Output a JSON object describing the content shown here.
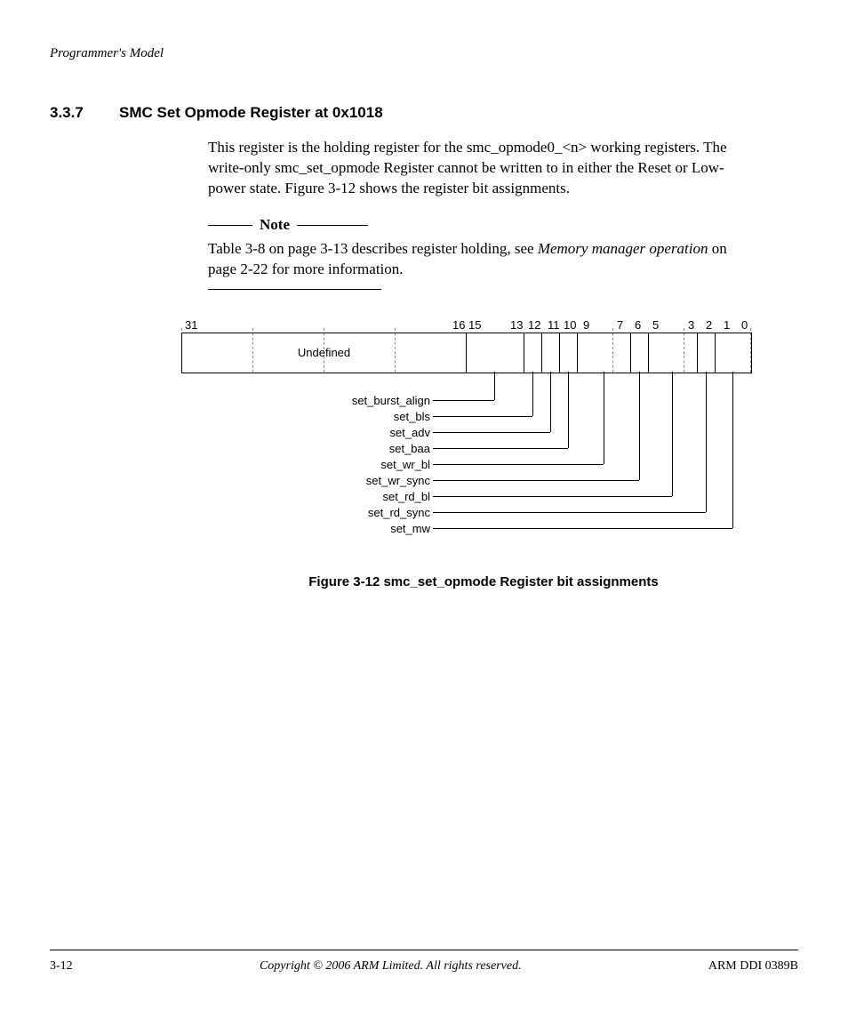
{
  "header": {
    "running": "Programmer's Model"
  },
  "section": {
    "number": "3.3.7",
    "title": "SMC Set Opmode Register at 0x1018"
  },
  "paragraph1": "This register is the holding register for the smc_opmode0_<n> working registers. The write-only smc_set_opmode Register cannot be written to in either the Reset or Low-power state. Figure 3-12 shows the register bit assignments.",
  "note": {
    "label": "Note",
    "body_pre": "Table 3-8 on page 3-13 describes register holding, see ",
    "body_em": "Memory manager operation",
    "body_post": " on page 2-22 for more information."
  },
  "diagram": {
    "bits_shown": [
      "31",
      "16",
      "15",
      "13",
      "12",
      "11",
      "10",
      "9",
      "7",
      "6",
      "5",
      "3",
      "2",
      "1",
      "0"
    ],
    "undefined_label": "Undefined",
    "fields": [
      {
        "name": "set_burst_align",
        "from": 15,
        "to": 13
      },
      {
        "name": "set_bls",
        "from": 12,
        "to": 12
      },
      {
        "name": "set_adv",
        "from": 11,
        "to": 11
      },
      {
        "name": "set_baa",
        "from": 10,
        "to": 10
      },
      {
        "name": "set_wr_bl",
        "from": 9,
        "to": 7
      },
      {
        "name": "set_wr_sync",
        "from": 6,
        "to": 6
      },
      {
        "name": "set_rd_bl",
        "from": 5,
        "to": 3
      },
      {
        "name": "set_rd_sync",
        "from": 2,
        "to": 2
      },
      {
        "name": "set_mw",
        "from": 1,
        "to": 0
      }
    ]
  },
  "figure_caption": "Figure 3-12 smc_set_opmode Register bit assignments",
  "footer": {
    "left": "3-12",
    "center": "Copyright © 2006 ARM Limited. All rights reserved.",
    "right": "ARM DDI 0389B"
  }
}
